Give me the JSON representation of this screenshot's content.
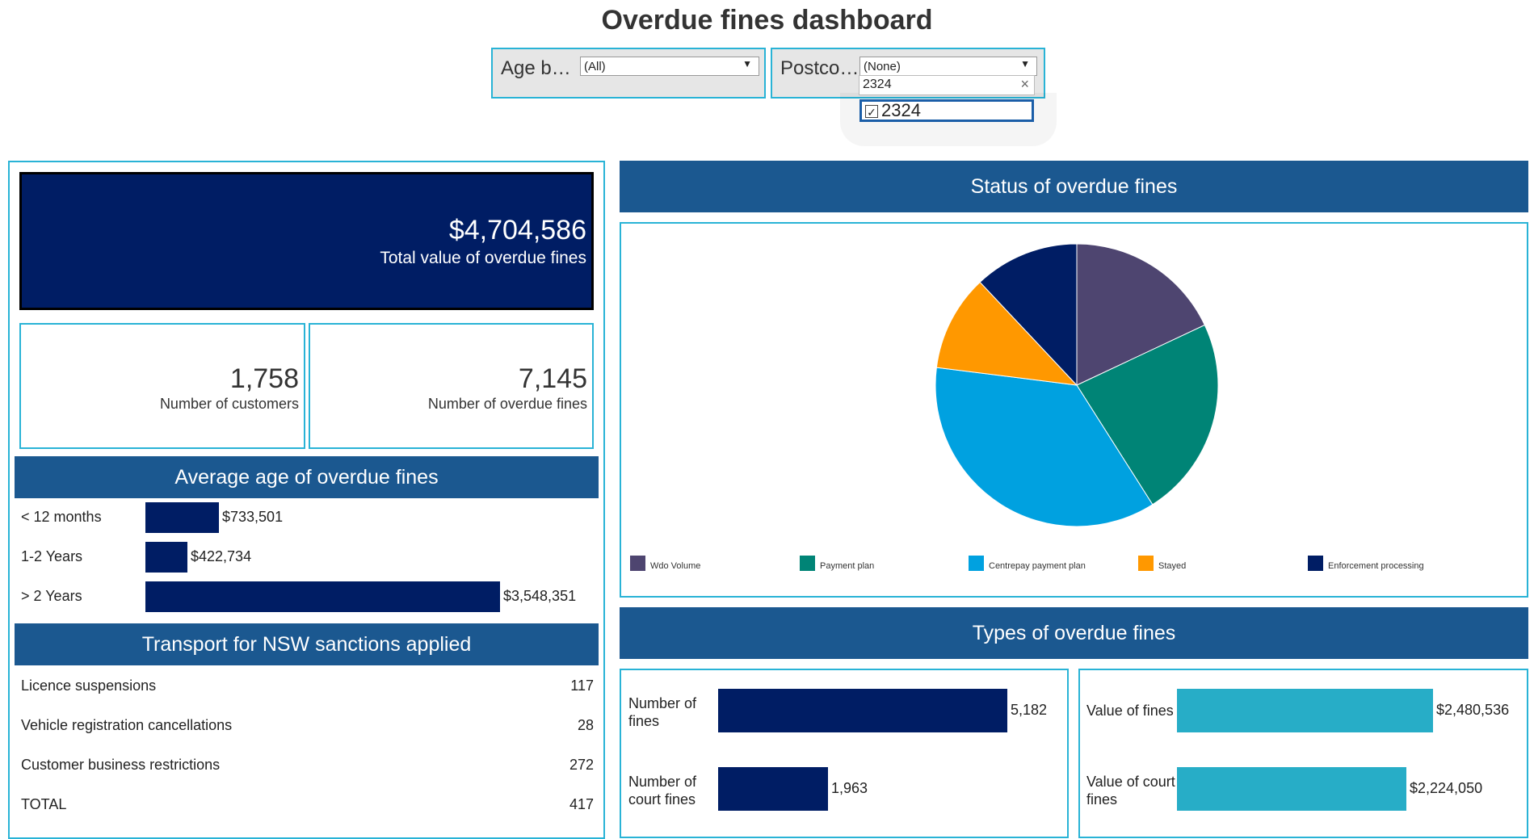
{
  "title": "Overdue fines dashboard",
  "filters": {
    "age": {
      "label": "Age b…",
      "value": "(All)"
    },
    "postcode": {
      "label": "Postco…",
      "value": "(None)",
      "search": "2324",
      "option": "2324",
      "option_checked": true
    }
  },
  "kpis": {
    "total_value": {
      "value": "$4,704,586",
      "label": "Total value of overdue fines"
    },
    "customers": {
      "value": "1,758",
      "label": "Number of customers"
    },
    "fines": {
      "value": "7,145",
      "label": "Number of overdue fines"
    }
  },
  "average_age": {
    "title": "Average age of overdue fines",
    "rows": [
      {
        "label": "< 12 months",
        "value": "$733,501"
      },
      {
        "label": "1-2 Years",
        "value": "$422,734"
      },
      {
        "label": "> 2 Years",
        "value": "$3,548,351"
      }
    ]
  },
  "sanctions": {
    "title": "Transport for NSW sanctions applied",
    "rows": [
      {
        "label": "Licence suspensions",
        "value": "117"
      },
      {
        "label": "Vehicle registration cancellations",
        "value": "28"
      },
      {
        "label": "Customer business restrictions",
        "value": "272"
      },
      {
        "label": "TOTAL",
        "value": "417"
      }
    ]
  },
  "status": {
    "title": "Status of overdue fines",
    "legend": [
      {
        "label": "Wdo Volume",
        "color": "#4e4570"
      },
      {
        "label": "Payment plan",
        "color": "#008476"
      },
      {
        "label": "Centrepay payment plan",
        "color": "#00a1e0"
      },
      {
        "label": "Stayed",
        "color": "#ff9800"
      },
      {
        "label": "Enforcement processing",
        "color": "#001d64"
      }
    ]
  },
  "types": {
    "title": "Types of overdue fines",
    "count_rows": [
      {
        "label": "Number of fines",
        "value": "5,182"
      },
      {
        "label": "Number of court fines",
        "value": "1,963"
      }
    ],
    "value_rows": [
      {
        "label": "Value of fines",
        "value": "$2,480,536"
      },
      {
        "label": "Value of court fines",
        "value": "$2,224,050"
      }
    ]
  },
  "chart_data": [
    {
      "type": "bar",
      "title": "Average age of overdue fines",
      "categories": [
        "< 12 months",
        "1-2 Years",
        "> 2 Years"
      ],
      "values": [
        733501,
        422734,
        3548351
      ]
    },
    {
      "type": "pie",
      "title": "Status of overdue fines",
      "categories": [
        "Wdo Volume",
        "Payment plan",
        "Centrepay payment plan",
        "Stayed",
        "Enforcement processing"
      ],
      "values": [
        18,
        23,
        36,
        11,
        12
      ]
    },
    {
      "type": "bar",
      "title": "Types of overdue fines",
      "categories": [
        "Number of fines",
        "Number of court fines"
      ],
      "values": [
        5182,
        1963
      ]
    },
    {
      "type": "bar",
      "title": "Types of overdue fines",
      "categories": [
        "Value of fines",
        "Value of court fines"
      ],
      "values": [
        2480536,
        2224050
      ]
    }
  ]
}
